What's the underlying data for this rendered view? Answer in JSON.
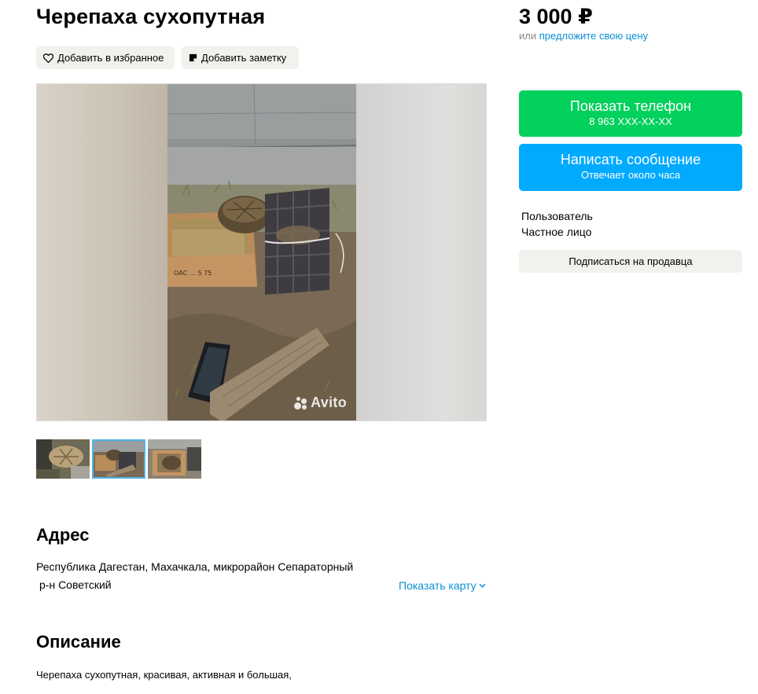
{
  "listing": {
    "title": "Черепаха сухопутная",
    "favorite_label": "Добавить в избранное",
    "note_label": "Добавить заметку"
  },
  "gallery": {
    "watermark": "Avito",
    "thumbnails": [
      {
        "icon": "turtle-photo-1"
      },
      {
        "icon": "turtle-photo-2",
        "active": true
      },
      {
        "icon": "turtle-photo-3"
      }
    ]
  },
  "address": {
    "heading": "Адрес",
    "line1": "Республика Дагестан, Махачкала, микрорайон Сепараторный",
    "line2": "р-н Советский",
    "map_link": "Показать карту"
  },
  "description": {
    "heading": "Описание",
    "text": "Черепаха сухопутная, красивая, активная и большая,"
  },
  "sidebar": {
    "price": "3 000 ₽",
    "or_label": "или",
    "offer_link": "предложите свою цену",
    "phone_button": {
      "label": "Показать телефон",
      "sub": "8 963 XXX-XX-XX",
      "color": "#02d15c"
    },
    "message_button": {
      "label": "Написать сообщение",
      "sub": "Отвечает около часа",
      "color": "#00aaff"
    },
    "seller_name": "Пользователь",
    "seller_type": "Частное лицо",
    "subscribe_label": "Подписаться на продавца"
  },
  "colors": {
    "link": "#0a8fd6",
    "pill_bg": "#f2f1ed",
    "thumb_active": "#4fb4e7"
  }
}
